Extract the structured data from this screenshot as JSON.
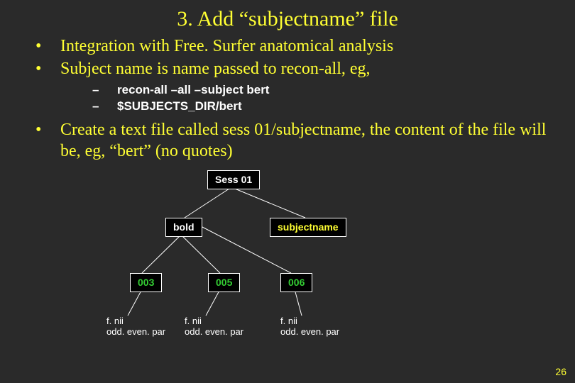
{
  "title": "3. Add “subjectname” file",
  "bullets": [
    "Integration with Free. Surfer anatomical analysis",
    "Subject name is name passed to recon-all, eg,"
  ],
  "subbullets": [
    "recon-all –all –subject bert",
    "$SUBJECTS_DIR/bert"
  ],
  "bullet3": "Create a text file called sess 01/subjectname, the content of the file will be, eg, “bert” (no quotes)",
  "diagram": {
    "root": "Sess 01",
    "bold": "bold",
    "subjectname": "subjectname",
    "runs": [
      "003",
      "005",
      "006"
    ],
    "leaf": "f. nii\nodd. even. par"
  },
  "slide_number": "26"
}
